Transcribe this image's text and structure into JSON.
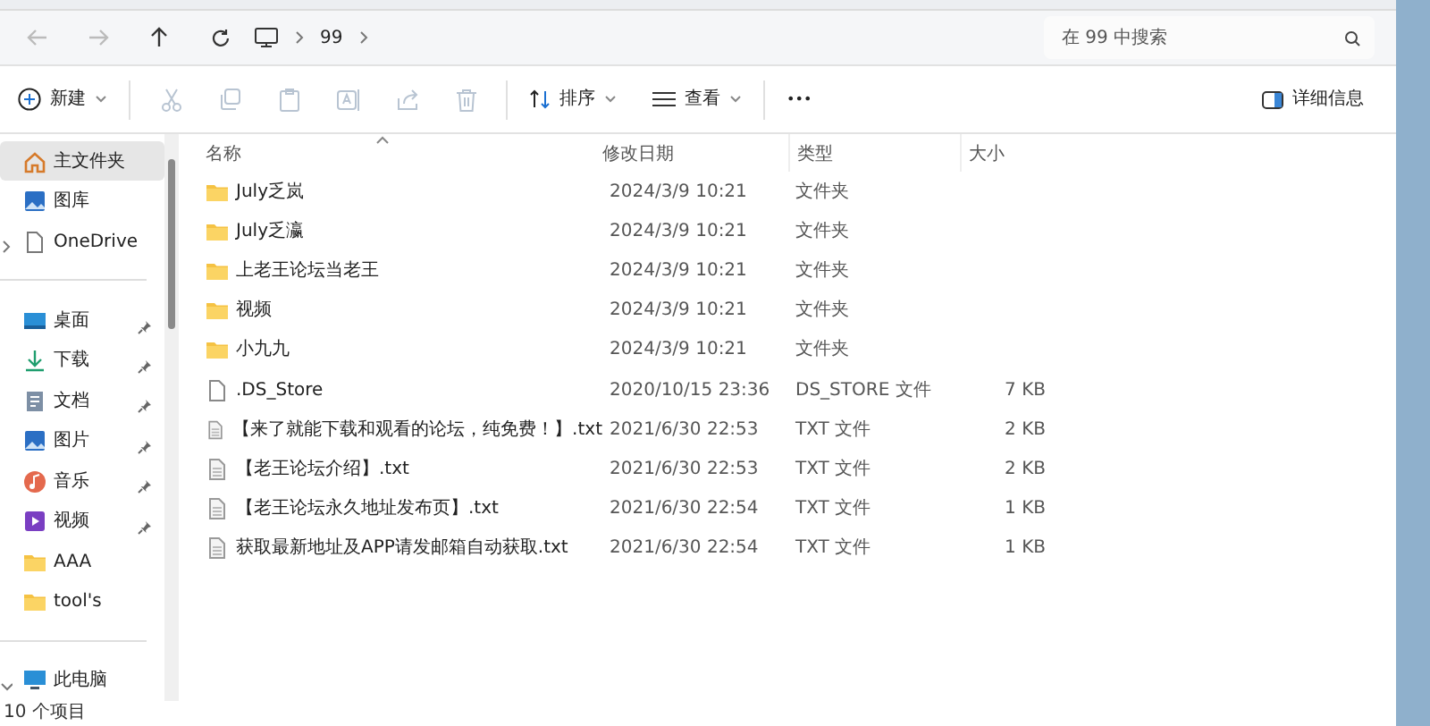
{
  "address": {
    "breadcrumb": [
      "99"
    ],
    "search": {
      "placeholder": "在 99 中搜索"
    }
  },
  "toolbar": {
    "new_label": "新建",
    "tools": [
      {
        "kind": "cut",
        "disabled": true
      },
      {
        "kind": "copy",
        "disabled": true
      },
      {
        "kind": "paste",
        "disabled": true
      },
      {
        "kind": "rename",
        "disabled": true
      },
      {
        "kind": "share",
        "disabled": true
      },
      {
        "kind": "delete",
        "disabled": true
      }
    ],
    "sort_label": "排序",
    "view_label": "查看",
    "more": "•••",
    "details_label": "详细信息"
  },
  "sidebar": {
    "sections": [
      {
        "items": [
          {
            "kind": "home",
            "label": "主文件夹",
            "selected": true
          },
          {
            "kind": "gallery",
            "label": "图库",
            "selected": false
          },
          {
            "kind": "cloud",
            "label": "OneDrive",
            "selected": false,
            "expanded": false
          }
        ]
      },
      {
        "items": [
          {
            "kind": "desktop",
            "label": "桌面",
            "selected": false,
            "pinned": true
          },
          {
            "kind": "download",
            "label": "下载",
            "selected": false,
            "pinned": true
          },
          {
            "kind": "document",
            "label": "文档",
            "selected": false,
            "pinned": true
          },
          {
            "kind": "gallery",
            "label": "图片",
            "selected": false,
            "pinned": true
          },
          {
            "kind": "music",
            "label": "音乐",
            "selected": false,
            "pinned": true
          },
          {
            "kind": "video",
            "label": "视频",
            "selected": false,
            "pinned": true
          },
          {
            "kind": "folder",
            "label": "AAA",
            "selected": false,
            "pinned": false
          },
          {
            "kind": "folder",
            "label": "tool's",
            "selected": false,
            "pinned": false
          }
        ]
      },
      {
        "items": [
          {
            "kind": "pc",
            "label": "此电脑",
            "selected": false,
            "expanded": true
          }
        ]
      }
    ]
  },
  "table": {
    "columns": [
      {
        "label": "名称",
        "sorted": true
      },
      {
        "label": "修改日期",
        "sorted": false
      },
      {
        "label": "类型",
        "sorted": false
      },
      {
        "label": "大小",
        "sorted": false
      }
    ],
    "rows": [
      {
        "kind": "folder",
        "name": "July乏岚",
        "date": "2024/3/9 10:21",
        "type": "文件夹"
      },
      {
        "kind": "folder",
        "name": "July乏瀛",
        "date": "2024/3/9 10:21",
        "type": "文件夹"
      },
      {
        "kind": "folder",
        "name": "上老王论坛当老王",
        "date": "2024/3/9 10:21",
        "type": "文件夹"
      },
      {
        "kind": "folder",
        "name": "视频",
        "date": "2024/3/9 10:21",
        "type": "文件夹"
      },
      {
        "kind": "folder",
        "name": "小九九",
        "date": "2024/3/9 10:21",
        "type": "文件夹"
      },
      {
        "kind": "file",
        "name": ".DS_Store",
        "date": "2020/10/15 23:36",
        "type": "DS_STORE 文件",
        "size": "7 KB"
      },
      {
        "kind": "text",
        "name": "【来了就能下载和观看的论坛，纯免费！】.txt",
        "date": "2021/6/30 22:53",
        "type": "TXT 文件",
        "size": "2 KB"
      },
      {
        "kind": "text",
        "name": "【老王论坛介绍】.txt",
        "date": "2021/6/30 22:53",
        "type": "TXT 文件",
        "size": "2 KB"
      },
      {
        "kind": "text",
        "name": "【老王论坛永久地址发布页】.txt",
        "date": "2021/6/30 22:54",
        "type": "TXT 文件",
        "size": "1 KB"
      },
      {
        "kind": "text",
        "name": "获取最新地址及APP请发邮箱自动获取.txt",
        "date": "2021/6/30 22:54",
        "type": "TXT 文件",
        "size": "1 KB"
      }
    ]
  },
  "status_bar": {
    "count": "10 个项目"
  }
}
